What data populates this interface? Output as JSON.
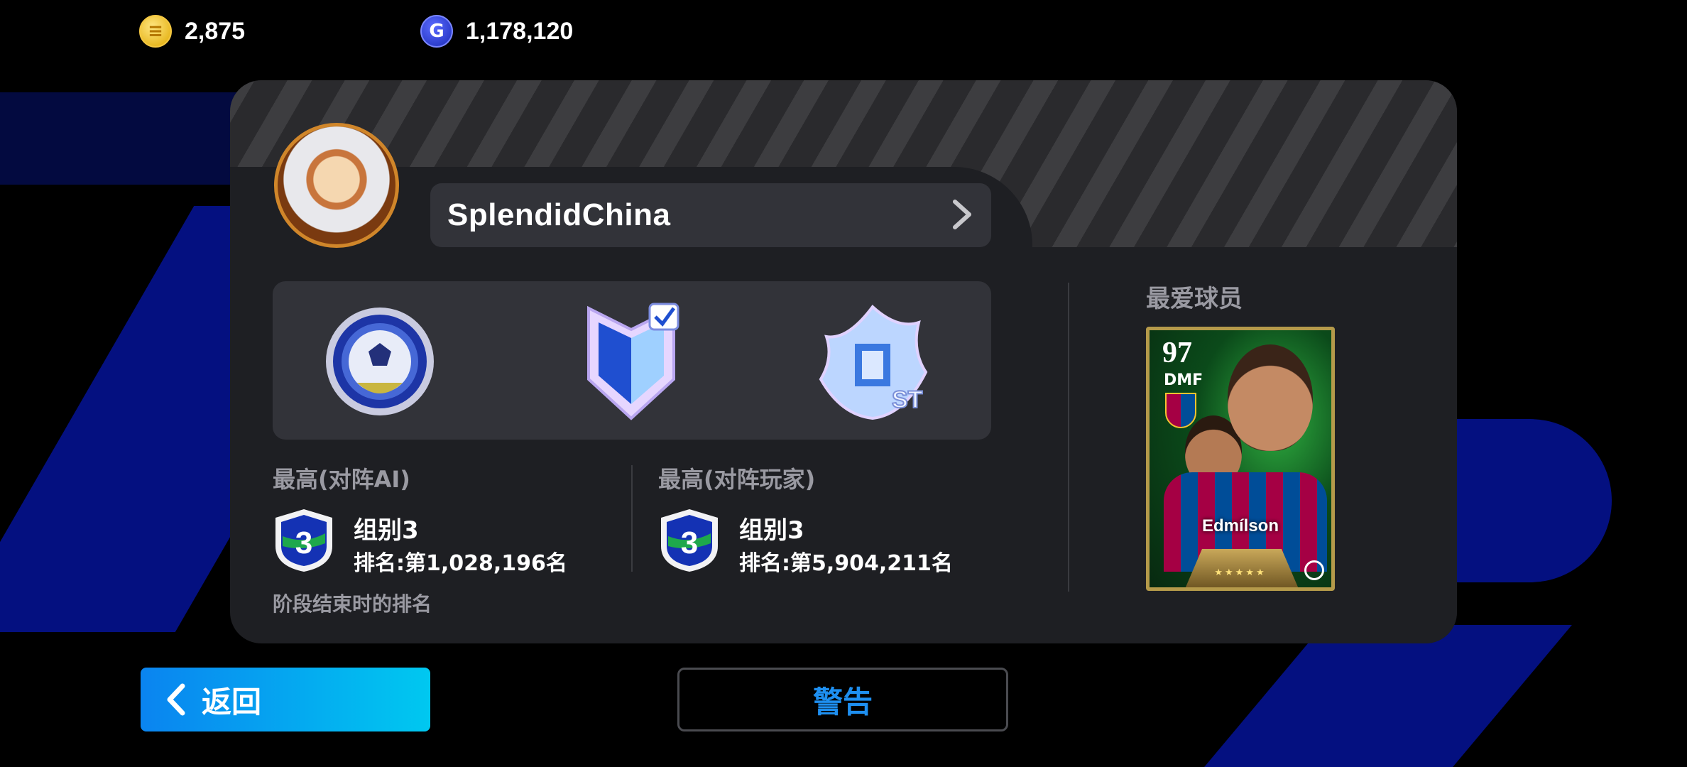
{
  "currency": {
    "ecoin": {
      "icon": "ecoin-icon",
      "value": "2,875"
    },
    "gp": {
      "icon": "gp-coin-icon",
      "value": "1,178,120"
    }
  },
  "profile": {
    "username": "SplendidChina",
    "badges": [
      "football-achievement-badge-icon",
      "checkmark-shield-badge-icon",
      "st-flame-badge-icon"
    ]
  },
  "rank_vs_ai": {
    "title": "最高(对阵AI)",
    "group": "组别3",
    "position": "排名:第1,028,196名"
  },
  "rank_vs_player": {
    "title": "最高(对阵玩家)",
    "group": "组别3",
    "position": "排名:第5,904,211名"
  },
  "rank_note": "阶段结束时的排名",
  "favourite": {
    "title": "最爱球员",
    "player": {
      "rating": "97",
      "position": "DMF",
      "name": "Edmílson",
      "stars": "★★★★★"
    }
  },
  "buttons": {
    "back": "返回",
    "warn": "警告"
  },
  "colors": {
    "background": "#000000",
    "card": "#1e1f23",
    "accent_blue": "#0a84f0",
    "warn_text": "#1e8ff0",
    "stripe_blue": "#041080"
  }
}
